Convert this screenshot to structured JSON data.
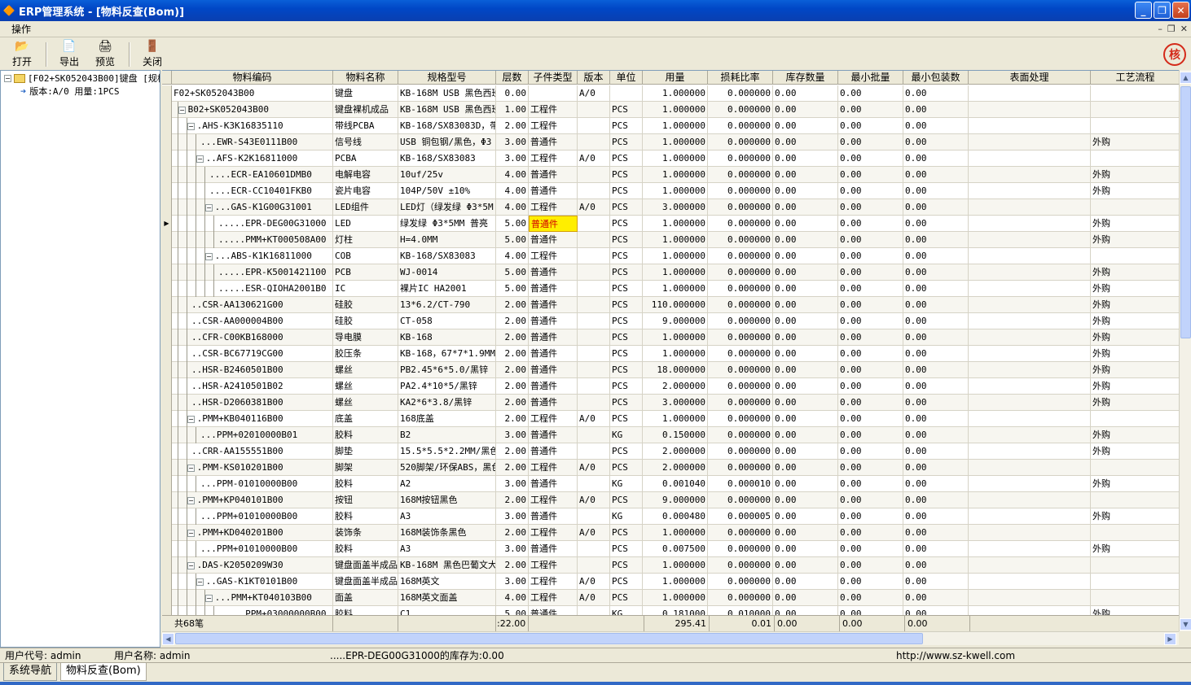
{
  "window": {
    "title": "ERP管理系统 - [物料反查(Bom)]"
  },
  "menu": {
    "items": [
      "操作"
    ]
  },
  "toolbar": {
    "open": "打开",
    "export": "导出",
    "preview": "预览",
    "close": "关闭"
  },
  "stamp": "核",
  "tree": {
    "root": "[F02+SK052043B00]键盘 [规格",
    "child": "版本:A/0  用量:1PCS"
  },
  "grid": {
    "columns": [
      "物料编码",
      "物料名称",
      "规格型号",
      "层数",
      "子件类型",
      "版本",
      "单位",
      "用量",
      "损耗比率",
      "库存数量",
      "最小批量",
      "最小包装数",
      "表面处理",
      "工艺流程"
    ],
    "rows": [
      [
        "F02+SK052043B00",
        "键盘",
        "KB-168M USB 黑色西班",
        "0.00",
        "",
        "A/0",
        "",
        "1.000000",
        "0.000000",
        "0.00",
        "0.00",
        "0.00",
        "",
        ""
      ],
      [
        ".B02+SK052043B00",
        "键盘裸机成品",
        "KB-168M USB 黑色西班",
        "1.00",
        "工程件",
        "",
        "PCS",
        "1.000000",
        "0.000000",
        "0.00",
        "0.00",
        "0.00",
        "",
        ""
      ],
      [
        "..AHS-K3K16835110",
        "带线PCBA",
        "KB-168/SX83083D，带线",
        "2.00",
        "工程件",
        "",
        "PCS",
        "1.000000",
        "0.000000",
        "0.00",
        "0.00",
        "0.00",
        "",
        ""
      ],
      [
        "...EWR-S43E0111B00",
        "信号线",
        "USB 铜包钢/黑色，Φ3",
        "3.00",
        "普通件",
        "",
        "PCS",
        "1.000000",
        "0.000000",
        "0.00",
        "0.00",
        "0.00",
        "",
        "外购"
      ],
      [
        "...AFS-K2K16811000",
        "PCBA",
        "KB-168/SX83083",
        "3.00",
        "工程件",
        "A/0",
        "PCS",
        "1.000000",
        "0.000000",
        "0.00",
        "0.00",
        "0.00",
        "",
        ""
      ],
      [
        "....ECR-EA10601DMB0",
        "电解电容",
        "10uf/25v",
        "4.00",
        "普通件",
        "",
        "PCS",
        "1.000000",
        "0.000000",
        "0.00",
        "0.00",
        "0.00",
        "",
        "外购"
      ],
      [
        "....ECR-CC10401FKB0",
        "瓷片电容",
        "104P/50V ±10%",
        "4.00",
        "普通件",
        "",
        "PCS",
        "1.000000",
        "0.000000",
        "0.00",
        "0.00",
        "0.00",
        "",
        "外购"
      ],
      [
        "....GAS-K1G00G31001",
        "LED组件",
        "LED灯（绿发绿 Φ3*5M",
        "4.00",
        "工程件",
        "A/0",
        "PCS",
        "3.000000",
        "0.000000",
        "0.00",
        "0.00",
        "0.00",
        "",
        ""
      ],
      [
        ".....EPR-DEG00G31000",
        "LED",
        "绿发绿 Φ3*5MM 普亮",
        "5.00",
        "普通件",
        "",
        "PCS",
        "1.000000",
        "0.000000",
        "0.00",
        "0.00",
        "0.00",
        "",
        "外购"
      ],
      [
        ".....PMM+KT000508A00",
        "灯柱",
        "H=4.0MM",
        "5.00",
        "普通件",
        "",
        "PCS",
        "1.000000",
        "0.000000",
        "0.00",
        "0.00",
        "0.00",
        "",
        "外购"
      ],
      [
        "....ABS-K1K16811000",
        "COB",
        "KB-168/SX83083",
        "4.00",
        "工程件",
        "",
        "PCS",
        "1.000000",
        "0.000000",
        "0.00",
        "0.00",
        "0.00",
        "",
        ""
      ],
      [
        ".....EPR-K5001421100",
        "PCB",
        "WJ-0014",
        "5.00",
        "普通件",
        "",
        "PCS",
        "1.000000",
        "0.000000",
        "0.00",
        "0.00",
        "0.00",
        "",
        "外购"
      ],
      [
        ".....ESR-QIOHA2001B0",
        "IC",
        "裸片IC HA2001",
        "5.00",
        "普通件",
        "",
        "PCS",
        "1.000000",
        "0.000000",
        "0.00",
        "0.00",
        "0.00",
        "",
        "外购"
      ],
      [
        "..CSR-AA130621G00",
        "硅胶",
        "13*6.2/CT-790",
        "2.00",
        "普通件",
        "",
        "PCS",
        "110.000000",
        "0.000000",
        "0.00",
        "0.00",
        "0.00",
        "",
        "外购"
      ],
      [
        "..CSR-AA000004B00",
        "硅胶",
        "CT-058",
        "2.00",
        "普通件",
        "",
        "PCS",
        "9.000000",
        "0.000000",
        "0.00",
        "0.00",
        "0.00",
        "",
        "外购"
      ],
      [
        "..CFR-C00KB168000",
        "导电膜",
        "KB-168",
        "2.00",
        "普通件",
        "",
        "PCS",
        "1.000000",
        "0.000000",
        "0.00",
        "0.00",
        "0.00",
        "",
        "外购"
      ],
      [
        "..CSR-BC67719CG00",
        "胶压条",
        "KB-168，67*7*1.9MM",
        "2.00",
        "普通件",
        "",
        "PCS",
        "1.000000",
        "0.000000",
        "0.00",
        "0.00",
        "0.00",
        "",
        "外购"
      ],
      [
        "..HSR-B2460501B00",
        "螺丝",
        "PB2.45*6*5.0/黑锌",
        "2.00",
        "普通件",
        "",
        "PCS",
        "18.000000",
        "0.000000",
        "0.00",
        "0.00",
        "0.00",
        "",
        "外购"
      ],
      [
        "..HSR-A2410501B02",
        "螺丝",
        "PA2.4*10*5/黑锌",
        "2.00",
        "普通件",
        "",
        "PCS",
        "2.000000",
        "0.000000",
        "0.00",
        "0.00",
        "0.00",
        "",
        "外购"
      ],
      [
        "..HSR-D2060381B00",
        "螺丝",
        "KA2*6*3.8/黑锌",
        "2.00",
        "普通件",
        "",
        "PCS",
        "3.000000",
        "0.000000",
        "0.00",
        "0.00",
        "0.00",
        "",
        "外购"
      ],
      [
        "..PMM+KB040116B00",
        "底盖",
        "168底盖",
        "2.00",
        "工程件",
        "A/0",
        "PCS",
        "1.000000",
        "0.000000",
        "0.00",
        "0.00",
        "0.00",
        "",
        ""
      ],
      [
        "...PPM+02010000B01",
        "胶料",
        "B2",
        "3.00",
        "普通件",
        "",
        "KG",
        "0.150000",
        "0.000000",
        "0.00",
        "0.00",
        "0.00",
        "",
        "外购"
      ],
      [
        "..CRR-AA155551B00",
        "脚垫",
        "15.5*5.5*2.2MM/黑色硅",
        "2.00",
        "普通件",
        "",
        "PCS",
        "2.000000",
        "0.000000",
        "0.00",
        "0.00",
        "0.00",
        "",
        "外购"
      ],
      [
        "..PMM-KS010201B00",
        "脚架",
        "520脚架/环保ABS，黑色",
        "2.00",
        "工程件",
        "A/0",
        "PCS",
        "2.000000",
        "0.000000",
        "0.00",
        "0.00",
        "0.00",
        "",
        ""
      ],
      [
        "...PPM-01010000B00",
        "胶料",
        "A2",
        "3.00",
        "普通件",
        "",
        "KG",
        "0.001040",
        "0.000010",
        "0.00",
        "0.00",
        "0.00",
        "",
        "外购"
      ],
      [
        "..PMM+KP040101B00",
        "按钮",
        "168M按钮黑色",
        "2.00",
        "工程件",
        "A/0",
        "PCS",
        "9.000000",
        "0.000000",
        "0.00",
        "0.00",
        "0.00",
        "",
        ""
      ],
      [
        "...PPM+01010000B00",
        "胶料",
        "A3",
        "3.00",
        "普通件",
        "",
        "KG",
        "0.000480",
        "0.000005",
        "0.00",
        "0.00",
        "0.00",
        "",
        "外购"
      ],
      [
        "..PMM+KD040201B00",
        "装饰条",
        "168M装饰条黑色",
        "2.00",
        "工程件",
        "A/0",
        "PCS",
        "1.000000",
        "0.000000",
        "0.00",
        "0.00",
        "0.00",
        "",
        ""
      ],
      [
        "...PPM+01010000B00",
        "胶料",
        "A3",
        "3.00",
        "普通件",
        "",
        "PCS",
        "0.007500",
        "0.000000",
        "0.00",
        "0.00",
        "0.00",
        "",
        "外购"
      ],
      [
        "..DAS-K2050209W30",
        "键盘面盖半成品",
        "KB-168M 黑色巴葡文大",
        "2.00",
        "工程件",
        "",
        "PCS",
        "1.000000",
        "0.000000",
        "0.00",
        "0.00",
        "0.00",
        "",
        ""
      ],
      [
        "...GAS-K1KT0101B00",
        "键盘面盖半成品",
        "168M英文",
        "3.00",
        "工程件",
        "A/0",
        "PCS",
        "1.000000",
        "0.000000",
        "0.00",
        "0.00",
        "0.00",
        "",
        ""
      ],
      [
        "....PMM+KT040103B00",
        "面盖",
        "168M英文面盖",
        "4.00",
        "工程件",
        "A/0",
        "PCS",
        "1.000000",
        "0.000000",
        "0.00",
        "0.00",
        "0.00",
        "",
        ""
      ],
      [
        ".....PPM+03000000B00",
        "胶料",
        "C1",
        "5.00",
        "普通件",
        "",
        "KG",
        "0.181000",
        "0.010000",
        "0.00",
        "0.00",
        "0.00",
        "",
        "外购"
      ]
    ]
  },
  "summary": {
    "count": "共68笔",
    "layers": ":22.00",
    "usage": "295.41",
    "loss": "0.01",
    "stock": "0.00",
    "minbatch": "0.00",
    "minpack": "0.00"
  },
  "status": {
    "user_code": "用户代号: admin",
    "user_name": "用户名称: admin",
    "message": ".....EPR-DEG00G31000的库存为:0.00",
    "url": "http://www.sz-kwell.com"
  },
  "tabs": [
    "系统导航",
    "物料反查(Bom)"
  ]
}
